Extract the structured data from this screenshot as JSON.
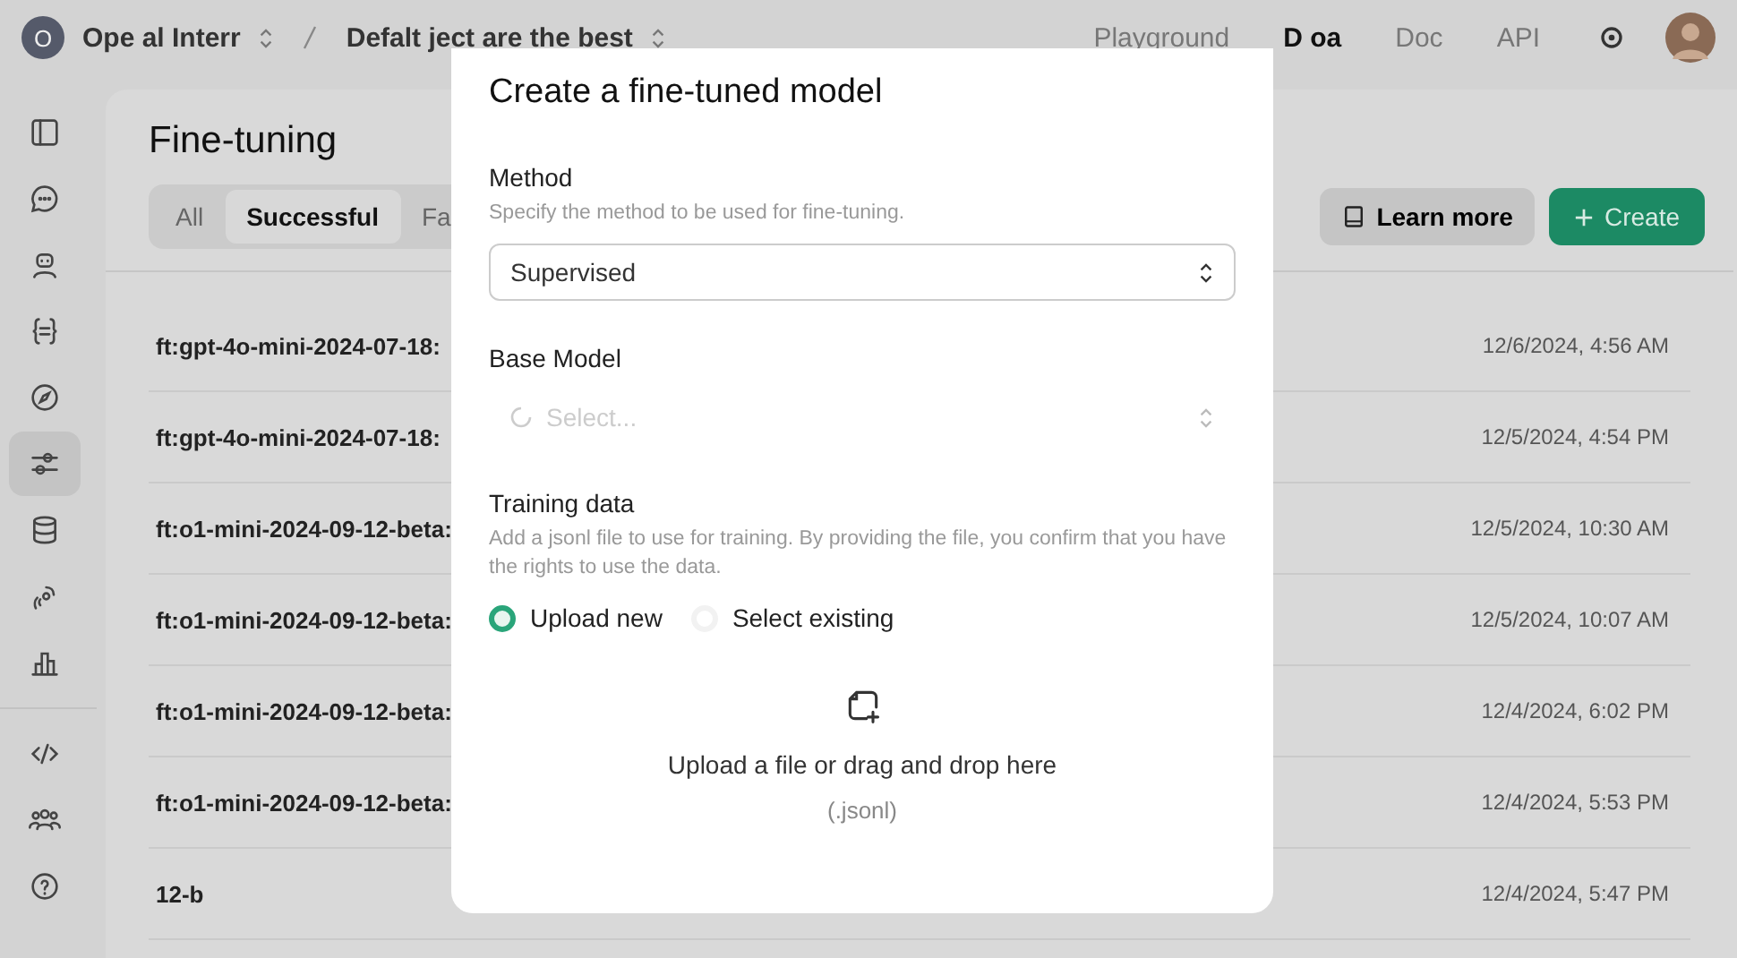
{
  "topbar": {
    "org_avatar": "O",
    "org_name": "Ope al Interr",
    "project": "Defalt ject are the best",
    "nav": [
      {
        "label": "Playground",
        "selected": false
      },
      {
        "label": "D oa",
        "selected": true
      },
      {
        "label": "Doc",
        "selected": false
      },
      {
        "label": "API",
        "selected": false
      }
    ]
  },
  "sidebar": {
    "items": [
      {
        "kind": "panel",
        "selected": false
      },
      {
        "kind": "chat",
        "selected": false
      },
      {
        "kind": "bot",
        "selected": false
      },
      {
        "kind": "braces",
        "selected": false
      },
      {
        "kind": "compass",
        "selected": false
      },
      {
        "kind": "sliders",
        "selected": true
      },
      {
        "kind": "database",
        "selected": false
      },
      {
        "kind": "speech",
        "selected": false
      },
      {
        "kind": "chart",
        "selected": false
      },
      {
        "kind": "code",
        "selected": false
      },
      {
        "kind": "people",
        "selected": false
      },
      {
        "kind": "help",
        "selected": false
      }
    ]
  },
  "page": {
    "title": "Fine-tuning",
    "tabs": [
      {
        "label": "All",
        "selected": false
      },
      {
        "label": "Successful",
        "selected": true
      },
      {
        "label": "Fa",
        "selected": false
      }
    ],
    "learn_more": "Learn more",
    "create": "Create",
    "rows": [
      {
        "name": "ft:gpt-4o-mini-2024-07-18:",
        "date": "12/6/2024, 4:56 AM"
      },
      {
        "name": "ft:gpt-4o-mini-2024-07-18:",
        "date": "12/5/2024, 4:54 PM"
      },
      {
        "name": "ft:o1-mini-2024-09-12-beta:",
        "date": "12/5/2024, 10:30 AM"
      },
      {
        "name": "ft:o1-mini-2024-09-12-beta:",
        "date": "12/5/2024, 10:07 AM"
      },
      {
        "name": "ft:o1-mini-2024-09-12-beta:",
        "date": "12/4/2024, 6:02 PM"
      },
      {
        "name": "ft:o1-mini-2024-09-12-beta:",
        "date": "12/4/2024, 5:53 PM"
      },
      {
        "name": "12-b",
        "date": "12/4/2024, 5:47 PM"
      }
    ]
  },
  "modal": {
    "title": "Create a fine-tuned model",
    "method": {
      "label": "Method",
      "hint": "Specify the method to be used for fine-tuning.",
      "value": "Supervised"
    },
    "base_model": {
      "label": "Base Model",
      "placeholder": "Select...",
      "loading": true
    },
    "training": {
      "label": "Training data",
      "hint": "Add a jsonl file to use for training. By providing the file, you confirm that you have the rights to use the data.",
      "options": [
        {
          "label": "Upload new",
          "selected": true
        },
        {
          "label": "Select existing",
          "selected": false
        }
      ],
      "drop_text": "Upload a file or drag and drop here",
      "drop_hint": "(.jsonl)"
    }
  }
}
